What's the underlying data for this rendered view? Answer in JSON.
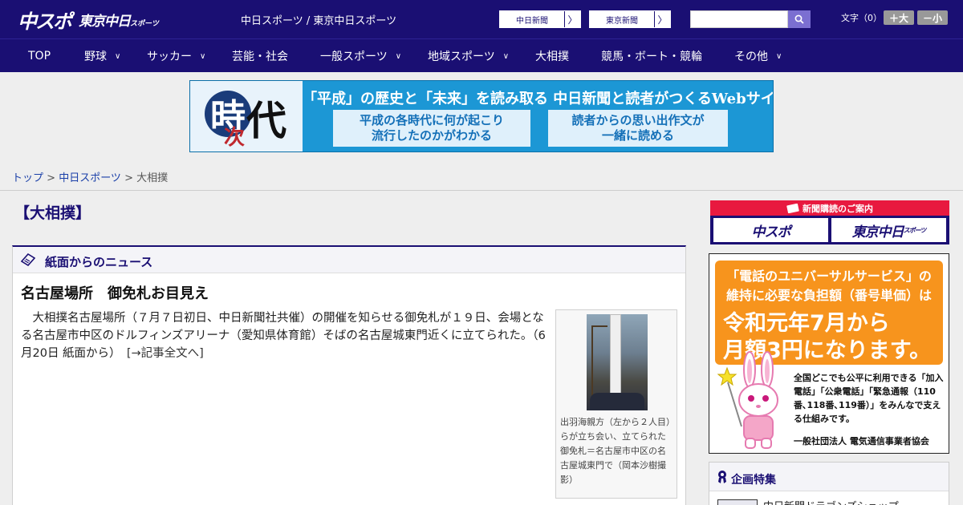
{
  "header": {
    "logo_main": "中スポ",
    "logo_sub": "東京中日",
    "logo_sub_small": "スポーツ",
    "title": "中日スポーツ / 東京中日スポーツ",
    "btn_chunichi": "中日新聞",
    "btn_tokyo": "東京新聞",
    "arrow": "〉",
    "search_placeholder": "",
    "fontsize_label": "文字（0）",
    "font_larger": "＋大",
    "font_smaller": "－小"
  },
  "nav": {
    "items": [
      {
        "label": "TOP",
        "dropdown": false
      },
      {
        "label": "野球",
        "dropdown": true
      },
      {
        "label": "サッカー",
        "dropdown": true
      },
      {
        "label": "芸能・社会",
        "dropdown": false
      },
      {
        "label": "一般スポーツ",
        "dropdown": true
      },
      {
        "label": "地域スポーツ",
        "dropdown": true
      },
      {
        "label": "大相撲",
        "dropdown": false
      },
      {
        "label": "競馬・ボート・競輪",
        "dropdown": false
      },
      {
        "label": "その他",
        "dropdown": true
      }
    ],
    "chevron": "∨"
  },
  "banner": {
    "ji": "時",
    "tsugi": "次",
    "dai": "代",
    "headline": "「平成」の歴史と「未来」を読み取る 中日新聞と読者がつくるWebサイト",
    "box1_line1": "平成の各時代に何が起こり",
    "box1_line2": "流行したのかがわかる",
    "box2_line1": "読者からの思い出作文が",
    "box2_line2": "一緒に読める"
  },
  "breadcrumb": {
    "home": "トップ",
    "sep": " > ",
    "section": "中日スポーツ",
    "current": "大相撲"
  },
  "category_title": "【大相撲】",
  "news": {
    "section_title": "紙面からのニュース",
    "article_title": "名古屋場所　御免札お目見え",
    "article_body": "　大相撲名古屋場所（７月７日初日、中日新聞社共催）の開催を知らせる御免札が１９日、会場となる名古屋市中区のドルフィンズアリーナ（愛知県体育館）そばの名古屋城東門近くに立てられた。（6月20日 紙面から）　",
    "more_link": "[→記事全文へ]",
    "photo_caption": "出羽海親方（左から２人目）らが立ち会い、立てられた御免札＝名古屋市中区の名古屋城東門で（岡本沙樹撮影）"
  },
  "sidebar": {
    "subscription_title": "新聞購読のご案内",
    "sub_logo1": "中スポ",
    "sub_logo2": "東京中日",
    "sub_logo2_small": "スポーツ",
    "ad_line1": "「電話のユニバーサルサービス」の",
    "ad_line2": "維持に必要な負担額（番号単価）は",
    "ad_big1": "令和元年7月から",
    "ad_big2": "月額3円になります。",
    "ad_text": "全国どこでも公平に利用できる「加入電話」「公衆電話」「緊急通報（110番､118番､119番）」をみんなで支える仕組みです。",
    "ad_org": "一般社団法人 電気通信事業者協会",
    "feature_title": "企画特集",
    "feature_link": "中日新聞ドラゴンズショップ"
  },
  "colors": {
    "brand_navy": "#1a0f73",
    "subscription_red": "#e8193f",
    "ad_orange": "#f7941d",
    "link_blue": "#1a3fa8"
  }
}
